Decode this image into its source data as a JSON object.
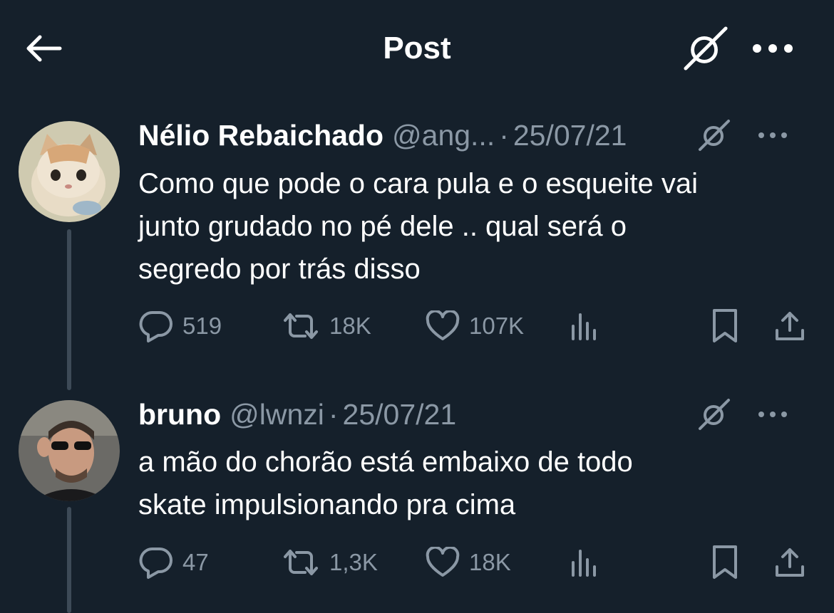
{
  "header": {
    "title": "Post",
    "back_icon": "arrow-left-icon",
    "grok_icon": "grok-icon",
    "more_icon": "more-horizontal-icon"
  },
  "tweets": [
    {
      "name": "Nélio Rebaichado",
      "handle": "@ang...",
      "separator": "·",
      "date": "25/07/21",
      "text": "Como que pode o cara  pula e o esqueite vai\njunto grudado no pé dele .. qual será o\nsegredo por trás disso",
      "replies": "519",
      "reposts": "18K",
      "likes": "107K",
      "avatar_icon": "kitten-avatar"
    },
    {
      "name": "bruno",
      "handle": "@lwnzi",
      "separator": "·",
      "date": "25/07/21",
      "text": "a mão do chorão está embaixo de todo\nskate impulsionando pra cima",
      "replies": "47",
      "reposts": "1,3K",
      "likes": "18K",
      "avatar_icon": "man-sunglasses-avatar"
    }
  ],
  "colors": {
    "background": "#15202b",
    "text": "#ffffff",
    "secondary": "#8b98a5",
    "thread_line": "#3d4a57"
  }
}
